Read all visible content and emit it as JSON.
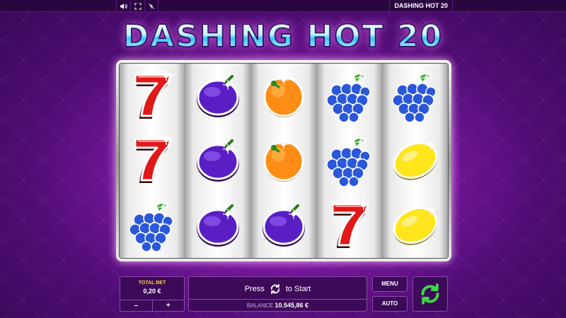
{
  "topbar": {
    "icons": [
      "speaker-icon",
      "fullscreen-icon",
      "turbo-icon"
    ],
    "game_name": "DASHING HOT 20"
  },
  "title": "DASHING HOT 20",
  "reels": [
    [
      "seven",
      "seven",
      "grapes"
    ],
    [
      "plum",
      "plum",
      "plum"
    ],
    [
      "orange",
      "orange",
      "plum"
    ],
    [
      "grapes",
      "grapes",
      "seven"
    ],
    [
      "grapes",
      "lemon",
      "lemon"
    ]
  ],
  "controls": {
    "total_bet_label": "TOTAL BET",
    "total_bet_value": "0,20 €",
    "decrease_label": "–",
    "increase_label": "+",
    "press_text": "Press",
    "to_start_text": "to Start",
    "balance_label": "BALANCE",
    "balance_value": "10.545,86 €",
    "menu_label": "MENU",
    "auto_label": "AUTO"
  },
  "colors": {
    "accent_green": "#3fd84a",
    "bet_label_yellow": "#ffd23a",
    "background_purple": "#7f1aa6"
  }
}
